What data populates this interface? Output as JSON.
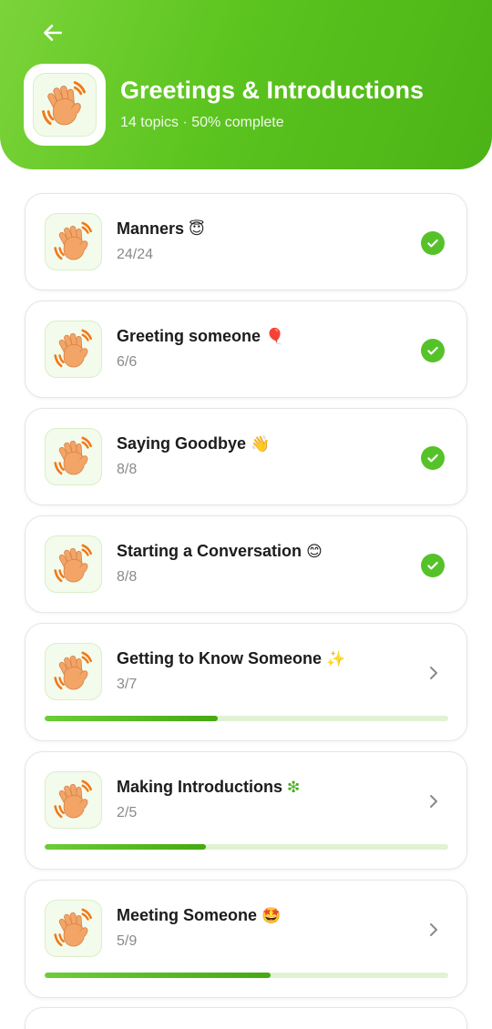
{
  "header": {
    "title": "Greetings & Introductions",
    "subtitle": "14 topics · 50% complete",
    "back_icon": "arrow-left-icon",
    "icon": "waving-hand-icon",
    "gradient": [
      "#7bd43a",
      "#4bb315"
    ]
  },
  "colors": {
    "accent": "#56c22a",
    "track": "#dff3d2",
    "muted": "#8a8a8a"
  },
  "topics": [
    {
      "title": "Manners",
      "emoji": "😇",
      "count": "24/24",
      "status": "complete"
    },
    {
      "title": "Greeting someone",
      "emoji": "🎈",
      "count": "6/6",
      "status": "complete"
    },
    {
      "title": "Saying Goodbye",
      "emoji": "👋",
      "count": "8/8",
      "status": "complete"
    },
    {
      "title": "Starting a Conversation",
      "emoji": "😊",
      "count": "8/8",
      "status": "complete"
    },
    {
      "title": "Getting to Know Someone",
      "emoji": "✨",
      "count": "3/7",
      "status": "in-progress",
      "progress": 0.43
    },
    {
      "title": "Making Introductions",
      "emoji": "❇",
      "count": "2/5",
      "status": "in-progress",
      "progress": 0.4
    },
    {
      "title": "Meeting Someone",
      "emoji": "🤩",
      "count": "5/9",
      "status": "in-progress",
      "progress": 0.56
    }
  ]
}
